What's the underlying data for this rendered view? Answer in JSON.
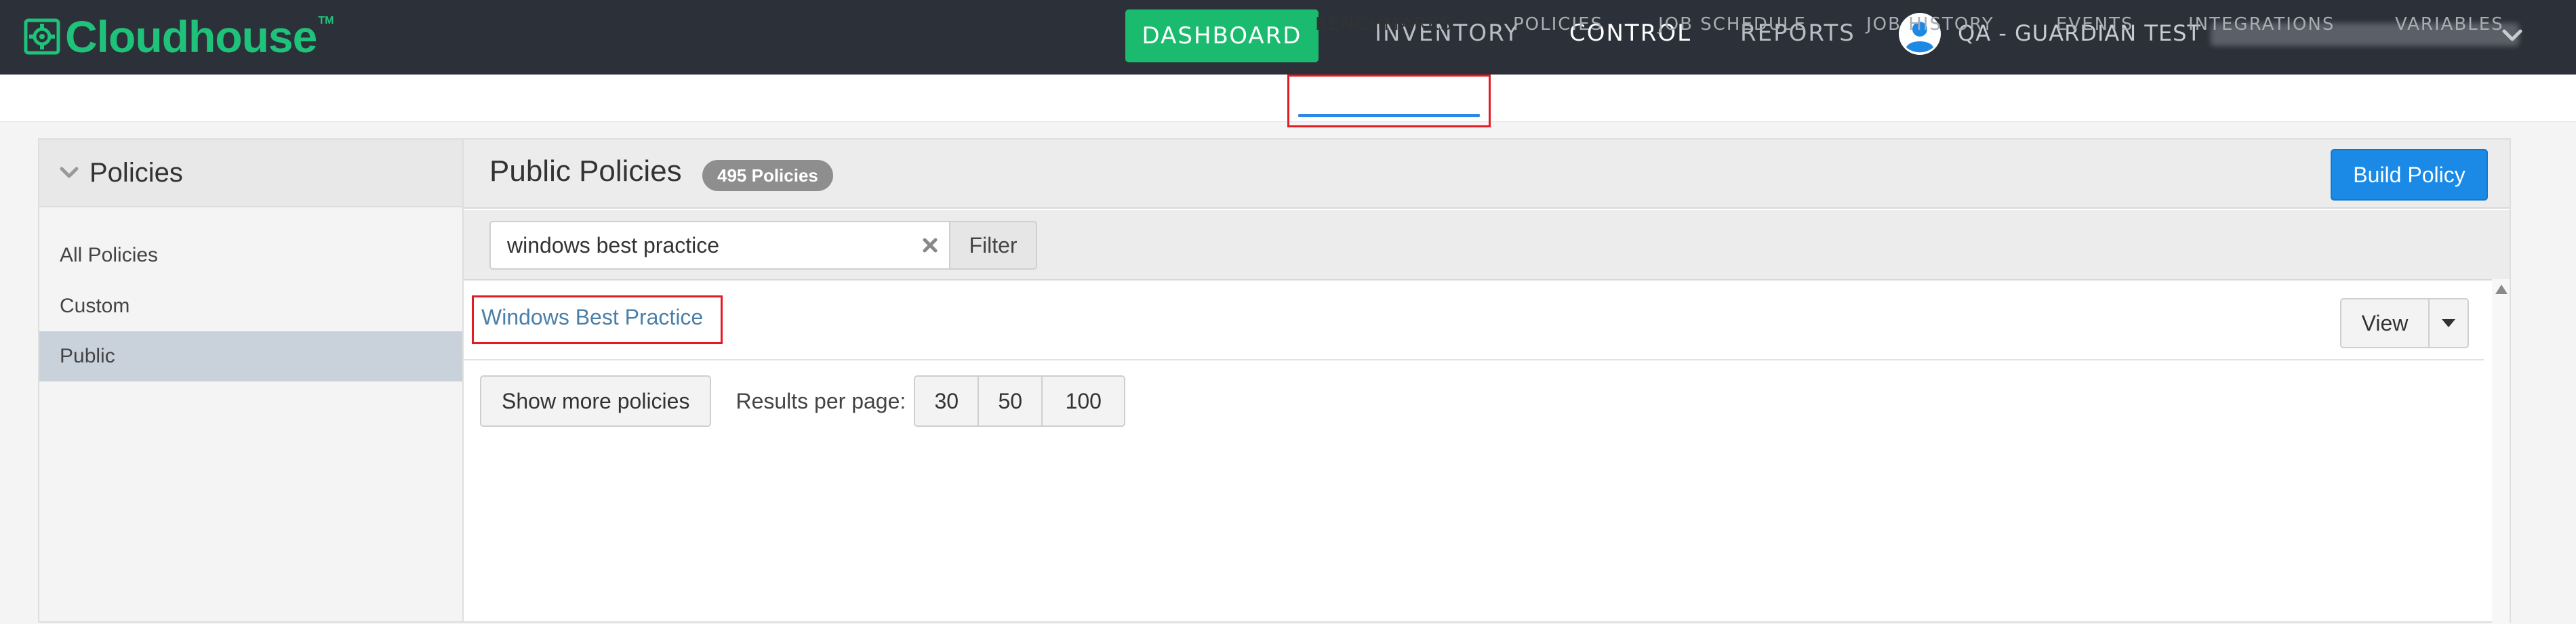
{
  "header": {
    "logo_text": "Cloudhouse",
    "logo_tm": "TM",
    "dashboard_label": "DASHBOARD",
    "nav": {
      "inventory": "INVENTORY",
      "control": "CONTROL",
      "reports": "REPORTS"
    },
    "user_label": "QA - GUARDIAN TEST",
    "brand_color": "#1fc27a"
  },
  "subnav": {
    "benchmarks": "BENCHMARKS",
    "policies": "POLICIES",
    "job_schedule": "JOB SCHEDULE",
    "job_history": "JOB HISTORY",
    "events": "EVENTS",
    "integrations": "INTEGRATIONS",
    "variables": "VARIABLES",
    "active": "BENCHMARKS"
  },
  "sidebar": {
    "title": "Policies",
    "items": [
      {
        "label": "All Policies",
        "selected": false
      },
      {
        "label": "Custom",
        "selected": false
      },
      {
        "label": "Public",
        "selected": true
      }
    ]
  },
  "main": {
    "title": "Public Policies",
    "count_badge": "495 Policies",
    "build_button": "Build Policy",
    "search": {
      "value": "windows best practice",
      "filter_label": "Filter"
    },
    "results": [
      {
        "name": "Windows Best Practice",
        "view_label": "View"
      }
    ],
    "show_more_label": "Show more policies",
    "results_per_page_label": "Results per page:",
    "page_sizes": [
      "30",
      "50",
      "100"
    ]
  }
}
